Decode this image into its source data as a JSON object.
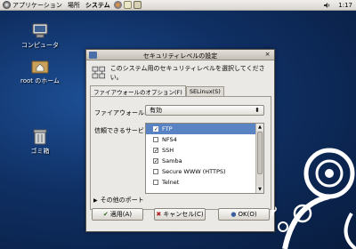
{
  "panel": {
    "menu_applications": "アプリケーション",
    "menu_places": "場所",
    "menu_system": "システム",
    "clock": "1:17",
    "icons": [
      "firefox-icon",
      "mail-icon",
      "note-icon"
    ]
  },
  "desktop": {
    "computer_label": "コンピュータ",
    "home_label": "root のホーム",
    "trash_label": "ゴミ箱"
  },
  "dialog": {
    "title": "セキュリティレベルの設定",
    "close_glyph": "×",
    "header_text": "このシステム用のセキュリティレベルを選択してください。",
    "tabs": [
      {
        "label": "ファイアウォールのオプション(F)",
        "active": true
      },
      {
        "label": "SELinux(S)",
        "active": false
      }
    ],
    "firewall_label": "ファイアウォール:",
    "firewall_value": "有効",
    "firewall_arrow": "⬍",
    "services_label": "信頼できるサービス:",
    "services": [
      {
        "name": "FTP",
        "checked": true,
        "selected": true,
        "mark": "✓"
      },
      {
        "name": "NFS4",
        "checked": false,
        "selected": false,
        "mark": ""
      },
      {
        "name": "SSH",
        "checked": true,
        "selected": false,
        "mark": "✓"
      },
      {
        "name": "Samba",
        "checked": true,
        "selected": false,
        "mark": "✓"
      },
      {
        "name": "Secure WWW (HTTPS)",
        "checked": false,
        "selected": false,
        "mark": ""
      },
      {
        "name": "Telnet",
        "checked": false,
        "selected": false,
        "mark": ""
      }
    ],
    "other_ports_label": "その他のポート",
    "other_ports_glyph": "▶",
    "apply_label": "適用(A)",
    "apply_glyph": "✔",
    "cancel_label": "キャンセル(C)",
    "cancel_glyph": "✖",
    "ok_label": "OK(O)",
    "ok_glyph": "●",
    "accent": "#5a83c4"
  }
}
